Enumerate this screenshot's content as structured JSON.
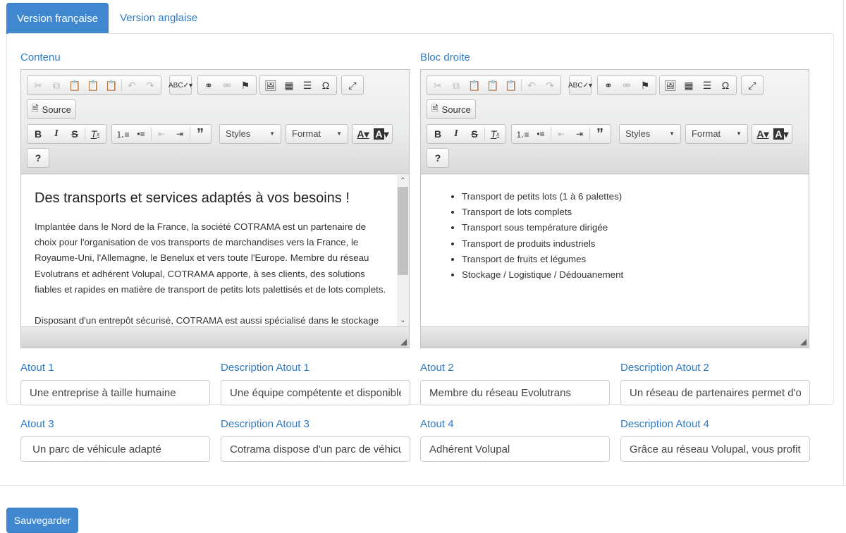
{
  "tabs": [
    {
      "label": "Version française",
      "active": true
    },
    {
      "label": "Version anglaise",
      "active": false
    }
  ],
  "editors": {
    "contenu": {
      "label": "Contenu",
      "heading": "Des transports et services adaptés à vos besoins !",
      "paragraphs": [
        "Implantée dans le Nord de la France, la société COTRAMA est un partenaire de choix pour l'organisation de vos transports de marchandises vers la France, le Royaume-Uni, l'Allemagne, le Benelux et vers toute l'Europe. Membre du réseau Evolutrans et adhérent Volupal, COTRAMA apporte, à ses clients, des solutions fiables et rapides en matière de transport de petits lots palettisés et de lots complets.",
        "Disposant d'un entrepôt sécurisé, COTRAMA est aussi spécialisé dans le stockage et la"
      ]
    },
    "bloc_droite": {
      "label": "Bloc droite",
      "items": [
        "Transport de petits lots (1 à 6 palettes)",
        "Transport de lots complets",
        "Transport sous température dirigée",
        "Transport de produits industriels",
        "Transport de fruits et légumes",
        "Stockage / Logistique / Dédouanement"
      ]
    },
    "toolbar": {
      "source_label": "Source",
      "styles_label": "Styles",
      "format_label": "Format",
      "help_label": "?"
    }
  },
  "atouts": [
    {
      "label": "Atout 1",
      "value": "Une entreprise à taille humaine",
      "desc_label": "Description Atout 1",
      "desc_value": "Une équipe compétente et disponible. Une"
    },
    {
      "label": "Atout 2",
      "value": "Membre du réseau Evolutrans",
      "desc_label": "Description Atout 2",
      "desc_value": "Un réseau de partenaires permet d'optimiser"
    },
    {
      "label": "Atout 3",
      "value": " Un parc de véhicule adapté",
      "desc_label": "Description Atout 3",
      "desc_value": "Cotrama dispose d'un parc de véhicules"
    },
    {
      "label": "Atout 4",
      "value": "Adhérent Volupal",
      "desc_label": "Description Atout 4",
      "desc_value": "Grâce au réseau Volupal, vous profitez de"
    }
  ],
  "save_label": "Sauvegarder",
  "colors": {
    "accent": "#3f88d0",
    "label": "#2f7bc6"
  }
}
